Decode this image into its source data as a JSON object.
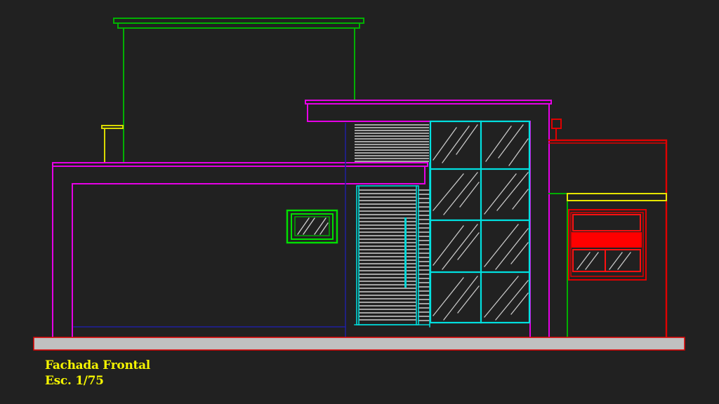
{
  "drawing": {
    "title": "Fachada Frontal",
    "scale": "Esc. 1/75"
  },
  "colors": {
    "background": "#212121",
    "magenta": "#e600e6",
    "green": "#00b000",
    "bright_green": "#00e000",
    "cyan": "#00e0e0",
    "red": "#e00000",
    "yellow": "#e6e600",
    "blue": "#2020a0",
    "white": "#ffffff",
    "ground": "#c0c0c0"
  }
}
